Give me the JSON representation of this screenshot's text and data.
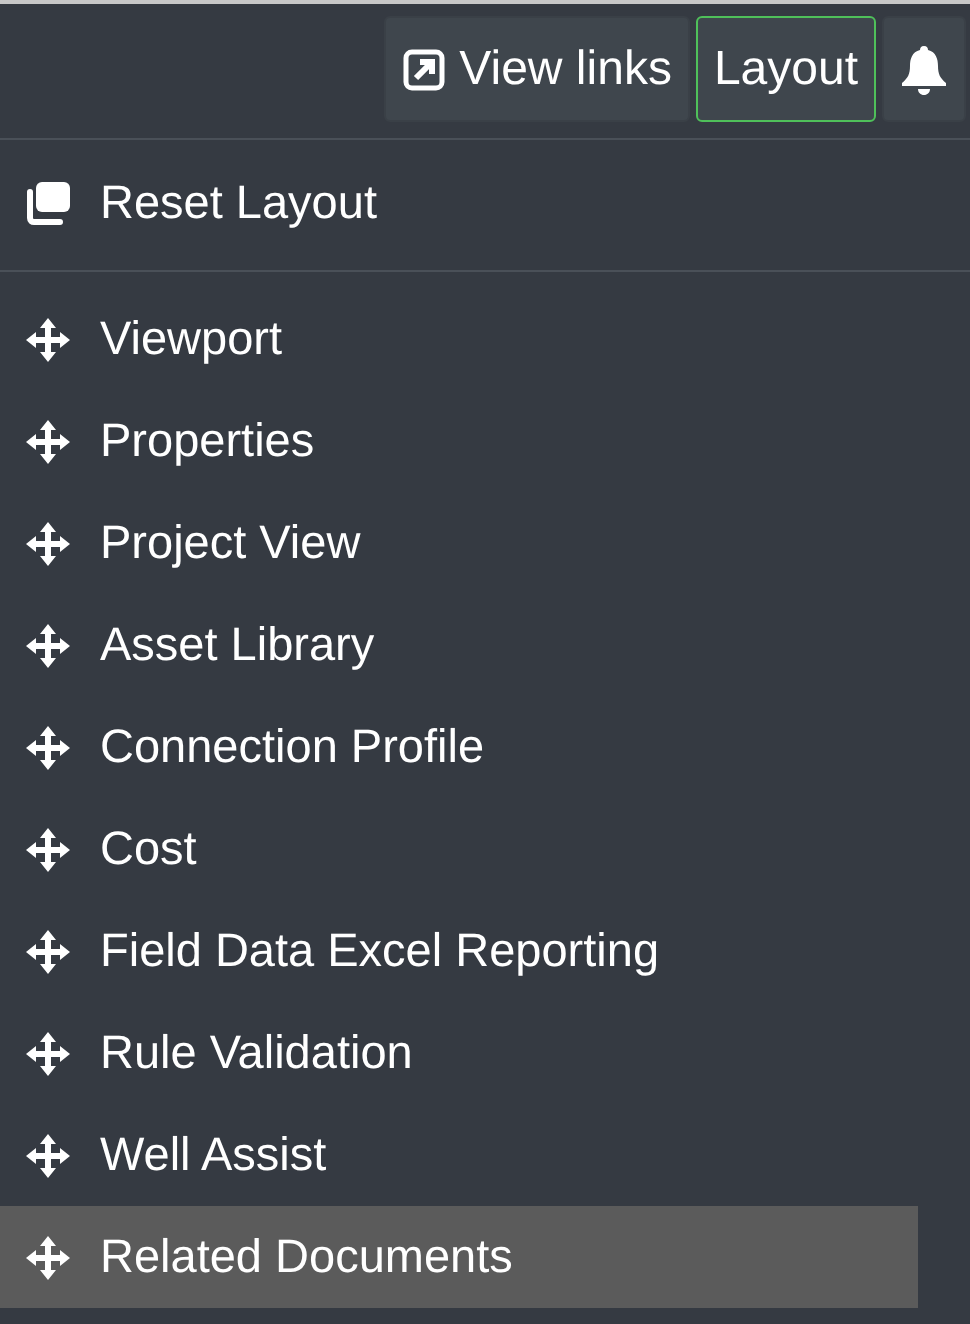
{
  "toolbar": {
    "buttons": [
      {
        "kind": "link",
        "label": "View links",
        "selected": false
      },
      {
        "kind": "text",
        "label": "Layout",
        "selected": true
      },
      {
        "kind": "bell",
        "selected": false
      }
    ]
  },
  "menu": {
    "reset": {
      "label": "Reset Layout"
    },
    "items": [
      {
        "label": "Viewport",
        "selected": false
      },
      {
        "label": "Properties",
        "selected": false
      },
      {
        "label": "Project View",
        "selected": false
      },
      {
        "label": "Asset Library",
        "selected": false
      },
      {
        "label": "Connection Profile",
        "selected": false
      },
      {
        "label": "Cost",
        "selected": false
      },
      {
        "label": "Field Data Excel Reporting",
        "selected": false
      },
      {
        "label": "Rule Validation",
        "selected": false
      },
      {
        "label": "Well Assist",
        "selected": false
      },
      {
        "label": "Related Documents",
        "selected": true
      }
    ]
  }
}
